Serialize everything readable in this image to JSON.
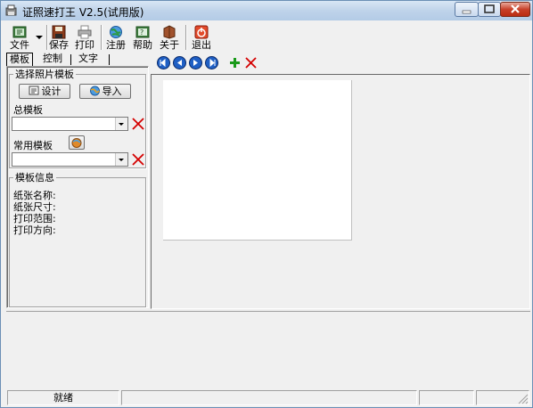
{
  "window": {
    "title": "证照速打王 V2.5(试用版)"
  },
  "toolbar": {
    "file": "文件",
    "save": "保存",
    "print": "打印",
    "register": "注册",
    "help": "帮助",
    "about": "关于",
    "exit": "退出"
  },
  "tabs": [
    "模板",
    "控制",
    "文字"
  ],
  "left": {
    "select_group": "选择照片模板",
    "design_btn": "设计",
    "import_btn": "导入",
    "master_template_label": "总模板",
    "master_template_value": "",
    "common_template_label": "常用模板",
    "common_template_value": "",
    "info_group": "模板信息",
    "info": {
      "paper_name": "纸张名称:",
      "paper_size": "纸张尺寸:",
      "print_range": "打印范围:",
      "print_direction": "打印方向:"
    }
  },
  "status": {
    "text": "就绪"
  },
  "colors": {
    "title_bar": "#c4d6ec",
    "close_button": "#c8412a",
    "canvas": "#ffffff",
    "delete_x": "#d40000",
    "add_plus": "#1a9a1a",
    "nav_blue": "#1f5fc4"
  }
}
